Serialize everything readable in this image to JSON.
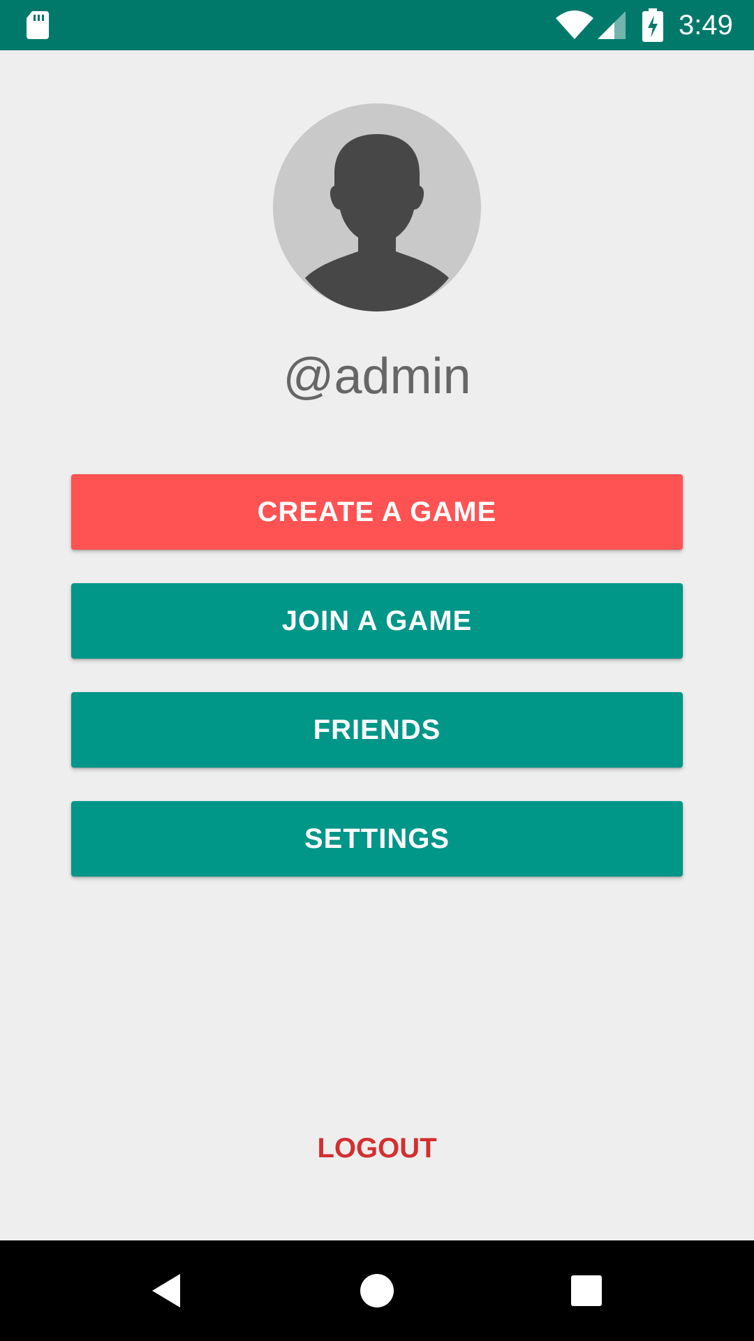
{
  "status_bar": {
    "time": "3:49",
    "icons": [
      "sd-card-icon",
      "wifi-icon",
      "cell-signal-icon",
      "battery-charging-icon"
    ]
  },
  "profile": {
    "avatar_icon": "person-silhouette-icon",
    "username": "@admin"
  },
  "menu": {
    "create_game": "CREATE A GAME",
    "join_game": "JOIN A GAME",
    "friends": "FRIENDS",
    "settings": "SETTINGS"
  },
  "logout": "LOGOUT",
  "nav_bar": {
    "icons": [
      "back-icon",
      "home-icon",
      "recents-icon"
    ]
  },
  "colors": {
    "status_bar": "#00796b",
    "primary": "#009688",
    "accent": "#ff5252",
    "logout_text": "#d32f2f",
    "background": "#eeeeee"
  }
}
